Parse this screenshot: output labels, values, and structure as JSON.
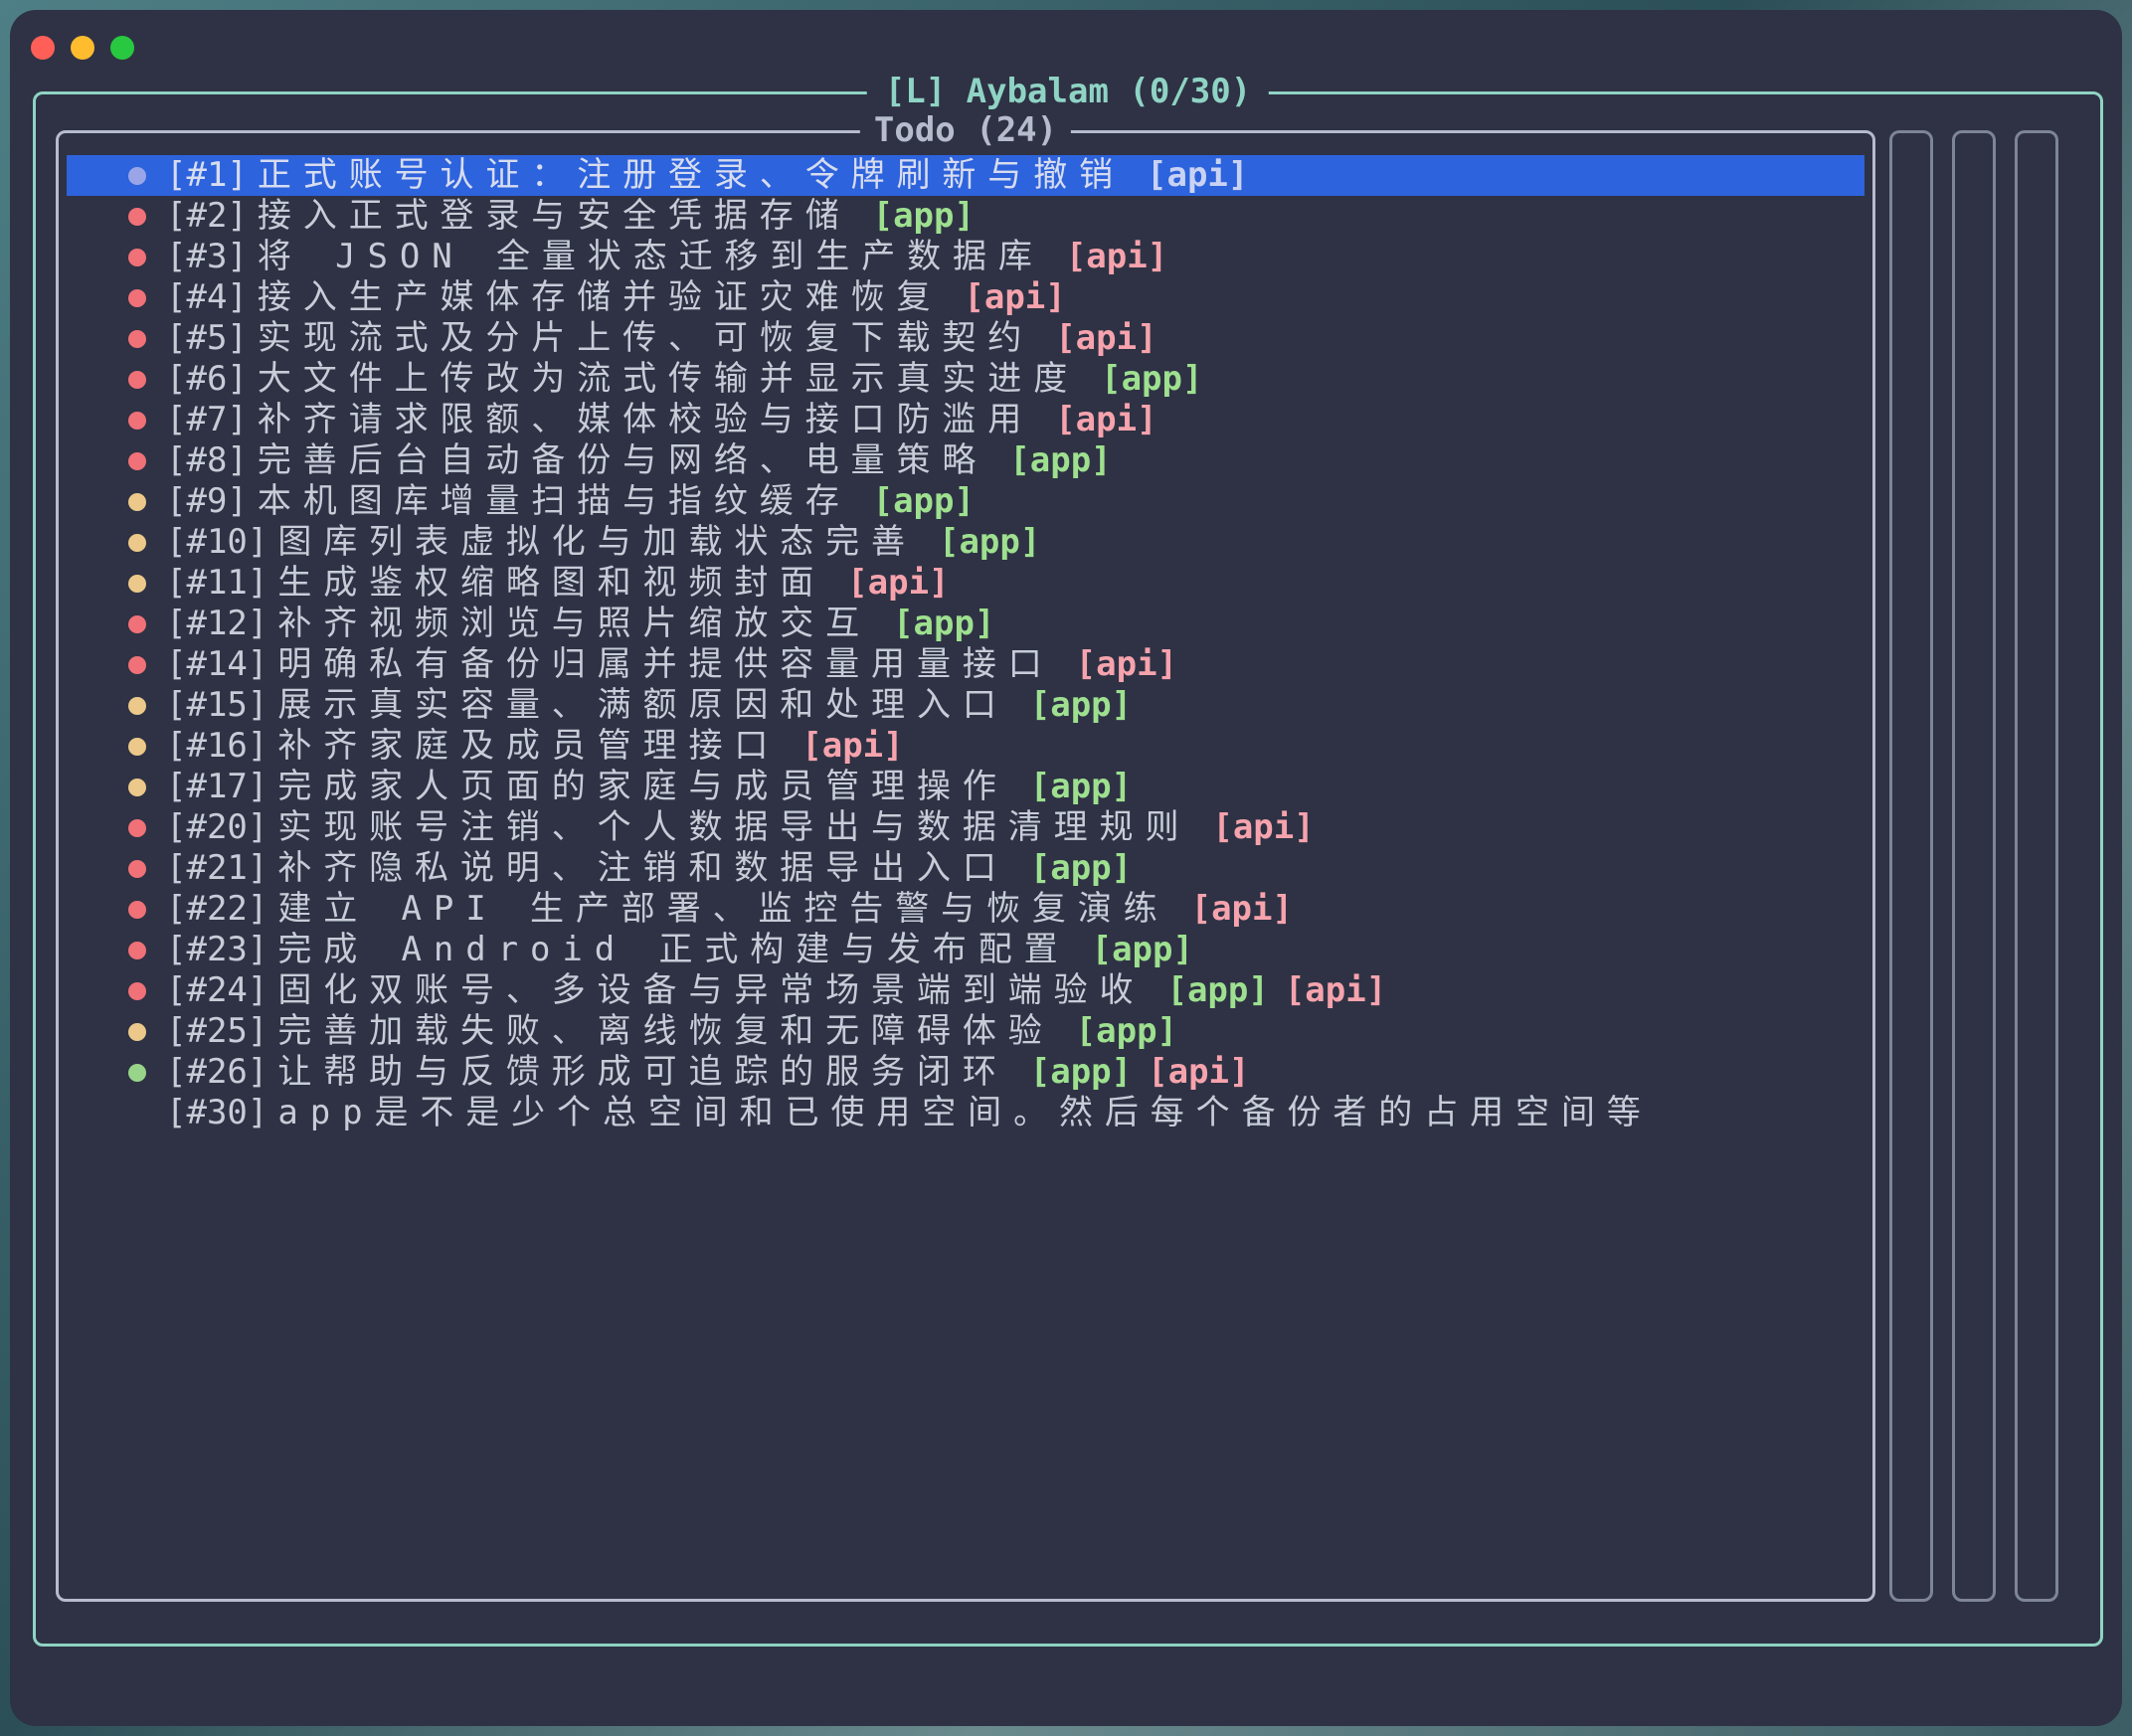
{
  "window": {
    "title": "[L] Aybalam (0/30)"
  },
  "panel": {
    "title": "Todo (24)"
  },
  "status_colors": {
    "selected": "#9aa5e8",
    "red": "#f07178",
    "yellow": "#ecc98a",
    "green": "#98d48a"
  },
  "tasks": [
    {
      "id": "[#1]",
      "text": "正式账号认证：注册登录、令牌刷新与撤销",
      "tags": [
        "[api]"
      ],
      "status": "selected"
    },
    {
      "id": "[#2]",
      "text": "接入正式登录与安全凭据存储",
      "tags": [
        "[app]"
      ],
      "status": "red"
    },
    {
      "id": "[#3]",
      "text": "将 JSON 全量状态迁移到生产数据库",
      "tags": [
        "[api]"
      ],
      "status": "red"
    },
    {
      "id": "[#4]",
      "text": "接入生产媒体存储并验证灾难恢复",
      "tags": [
        "[api]"
      ],
      "status": "red"
    },
    {
      "id": "[#5]",
      "text": "实现流式及分片上传、可恢复下载契约",
      "tags": [
        "[api]"
      ],
      "status": "red"
    },
    {
      "id": "[#6]",
      "text": "大文件上传改为流式传输并显示真实进度",
      "tags": [
        "[app]"
      ],
      "status": "red"
    },
    {
      "id": "[#7]",
      "text": "补齐请求限额、媒体校验与接口防滥用",
      "tags": [
        "[api]"
      ],
      "status": "red"
    },
    {
      "id": "[#8]",
      "text": "完善后台自动备份与网络、电量策略",
      "tags": [
        "[app]"
      ],
      "status": "red"
    },
    {
      "id": "[#9]",
      "text": "本机图库增量扫描与指纹缓存",
      "tags": [
        "[app]"
      ],
      "status": "yellow"
    },
    {
      "id": "[#10]",
      "text": "图库列表虚拟化与加载状态完善",
      "tags": [
        "[app]"
      ],
      "status": "yellow"
    },
    {
      "id": "[#11]",
      "text": "生成鉴权缩略图和视频封面",
      "tags": [
        "[api]"
      ],
      "status": "yellow"
    },
    {
      "id": "[#12]",
      "text": "补齐视频浏览与照片缩放交互",
      "tags": [
        "[app]"
      ],
      "status": "red"
    },
    {
      "id": "[#14]",
      "text": "明确私有备份归属并提供容量用量接口",
      "tags": [
        "[api]"
      ],
      "status": "red"
    },
    {
      "id": "[#15]",
      "text": "展示真实容量、满额原因和处理入口",
      "tags": [
        "[app]"
      ],
      "status": "yellow"
    },
    {
      "id": "[#16]",
      "text": "补齐家庭及成员管理接口",
      "tags": [
        "[api]"
      ],
      "status": "yellow"
    },
    {
      "id": "[#17]",
      "text": "完成家人页面的家庭与成员管理操作",
      "tags": [
        "[app]"
      ],
      "status": "yellow"
    },
    {
      "id": "[#20]",
      "text": "实现账号注销、个人数据导出与数据清理规则",
      "tags": [
        "[api]"
      ],
      "status": "red"
    },
    {
      "id": "[#21]",
      "text": "补齐隐私说明、注销和数据导出入口",
      "tags": [
        "[app]"
      ],
      "status": "red"
    },
    {
      "id": "[#22]",
      "text": "建立 API 生产部署、监控告警与恢复演练",
      "tags": [
        "[api]"
      ],
      "status": "red"
    },
    {
      "id": "[#23]",
      "text": "完成 Android 正式构建与发布配置",
      "tags": [
        "[app]"
      ],
      "status": "red"
    },
    {
      "id": "[#24]",
      "text": "固化双账号、多设备与异常场景端到端验收",
      "tags": [
        "[app]",
        "[api]"
      ],
      "status": "red"
    },
    {
      "id": "[#25]",
      "text": "完善加载失败、离线恢复和无障碍体验",
      "tags": [
        "[app]"
      ],
      "status": "yellow"
    },
    {
      "id": "[#26]",
      "text": "让帮助与反馈形成可追踪的服务闭环",
      "tags": [
        "[app]",
        "[api]"
      ],
      "status": "green"
    },
    {
      "id": "[#30]",
      "text": "app是不是少个总空间和已使用空间。然后每个备份者的占用空间等",
      "tags": [],
      "status": "none"
    }
  ]
}
